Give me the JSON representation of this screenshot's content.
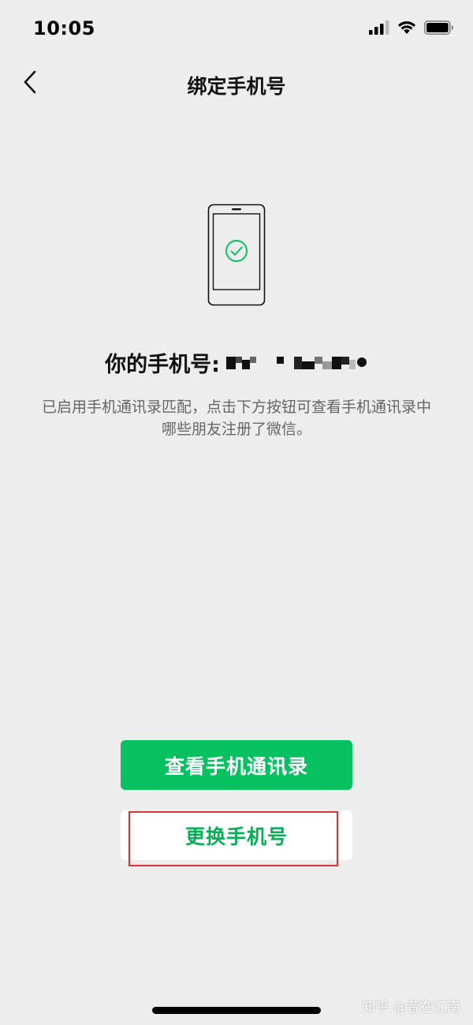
{
  "status_bar": {
    "time": "10:05"
  },
  "nav": {
    "title": "绑定手机号"
  },
  "phone": {
    "label": "你的手机号:"
  },
  "description": {
    "line1": "已启用手机通讯录匹配，点击下方按钮可查看手机通讯录中",
    "line2": "哪些朋友注册了微信。"
  },
  "buttons": {
    "view_contacts": "查看手机通讯录",
    "change_phone": "更换手机号"
  },
  "watermark": "知乎 @昔在江南",
  "icons": {
    "back": "chevron-left-icon",
    "signal": "cellular-signal-icon",
    "wifi": "wifi-icon",
    "battery": "battery-icon",
    "phone_check": "phone-check-icon"
  },
  "colors": {
    "primary": "#07c160",
    "secondary_text": "#06ae56",
    "highlight": "#d9303a",
    "background": "#ededed"
  }
}
